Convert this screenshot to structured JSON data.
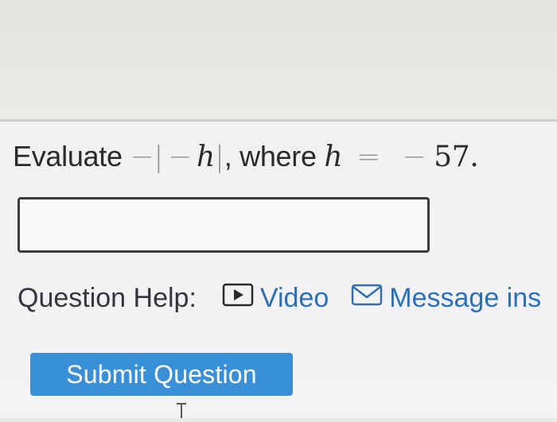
{
  "question": {
    "verb": "Evaluate",
    "minus_outer": "−",
    "bar_open": "|",
    "minus_inner": "−",
    "var": "h",
    "bar_close": "|",
    "comma_where": ", where",
    "var2": "h",
    "equals": "=",
    "neg": "−",
    "value": "57.",
    "answer_value": ""
  },
  "help": {
    "label": "Question Help:",
    "video_label": "Video",
    "video_icon": "play-icon",
    "message_label": "Message ins",
    "message_icon": "envelope-icon",
    "link_color": "#2c6fb3"
  },
  "submit": {
    "label": "Submit Question",
    "color": "#3a90d6"
  }
}
